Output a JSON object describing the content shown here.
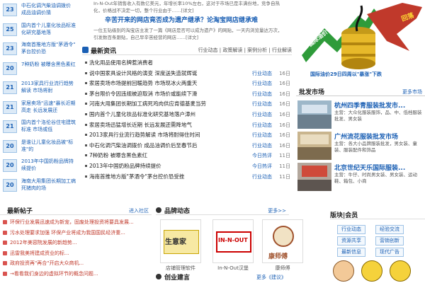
{
  "left_list": [
    {
      "day": "23",
      "text": "中石化调汽柴油调拨价 成品油调价猜"
    },
    {
      "day": "25",
      "text": "国内首个儿童化妆品标准化研究基地落"
    },
    {
      "day": "23",
      "text": "海南首推地方版\"茅酒令\" 茅台控价恐"
    },
    {
      "day": "20",
      "text": "7种奶粉 被曝含黑色素红"
    },
    {
      "day": "21",
      "text": "2013家具行业流行趋势解读 市场将耐"
    },
    {
      "day": "21",
      "text": "家居卖场\"迅速\"暴长近期高走 长远发展还"
    },
    {
      "day": "21",
      "text": "国内首个洛伦谷住宅建筑标准 市场或低"
    },
    {
      "day": "20",
      "text": "是谁让儿童化妆品被\"标准\"的"
    },
    {
      "day": "20",
      "text": "2013年中国奶粉品牌持续提价"
    },
    {
      "day": "20",
      "text": "海南大用集团长期加工病死猪肉的场"
    }
  ],
  "midtop": {
    "p1": "In-N-Out年销售收入有数亿美元，年增长率10%左右，这对于市场已是丰满份地，竞争自热化，价格战不决定一切，整个行业由于……[详文]",
    "headline": "辛苦开来的网店竟否成为遗产继承？论淘宝网店继承难",
    "p2": "一位五钻级别的淘宝店主发了一篇《网店是否可以成为遗产》的网贴，一天内浏览量达万次，引发数百条跟贴，自己早辛苦经营的网店……[详文]"
  },
  "news": {
    "title": "最新资讯",
    "tabs": "行业动态 | 政策解读 | 案例分析 | 行业解读",
    "items": [
      {
        "t": "洗化用品使用名牌惹消费者",
        "c": "",
        "d": ""
      },
      {
        "t": "说中国家具设计风格的演变 深度送失造就辉诞",
        "c": "行业动态",
        "d": "16日"
      },
      {
        "t": "家居卖场市场提前回暖趋势 市场现冰火两重天",
        "c": "行业动态",
        "d": "16日"
      },
      {
        "t": "茅台限价令因违规被迫取消 市场价或能续下滑",
        "c": "行业动态",
        "d": "16日"
      },
      {
        "t": "河南大用集团长期加工病死鸡肉供应肯德基麦当劳",
        "c": "行业动态",
        "d": "16日"
      },
      {
        "t": "国内首个儿童化妆品标准化研究基地落户漳州",
        "c": "行业动态",
        "d": "16日"
      },
      {
        "t": "家居卖场迅猛增长近期 长远发展还需降地气",
        "c": "行业动态",
        "d": "16日"
      },
      {
        "t": "2013家具行业流行趋势解读 市场将耐得住时间",
        "c": "行业动态",
        "d": "16日"
      },
      {
        "t": "中石化调汽柴油调拨价 成品油调价后至春节后",
        "c": "行业动态",
        "d": "16日"
      },
      {
        "t": "7种奶粉 被曝含黑色素红",
        "c": "今日热评",
        "d": "11日"
      },
      {
        "t": "2013年中国奶粉品牌持续提价",
        "c": "今日热评",
        "d": "11日"
      },
      {
        "t": "海南首推地方版\"茅酒令\"茅台控价恐受挫",
        "c": "行业动态",
        "d": "11日"
      }
    ]
  },
  "ad": {
    "banner": "国际油价29日四周以\"暴涨\"下跌"
  },
  "market": {
    "title": "批发市场",
    "more": "更多市场",
    "items": [
      {
        "name": "杭州四季青服装批发市...",
        "desc": "主营：大众化服装服饰，品、中、低档服装批发、男女装"
      },
      {
        "name": "广州流花服装批发市场",
        "desc": "主营：各大小品牌服装批发，男女装、童装、服装配件和饰品"
      },
      {
        "name": "北京世纪天乐国际服装...",
        "desc": "主营：牛仔、时尚男女装、男女装、运动鞋、箱包、小商"
      }
    ]
  },
  "posts": {
    "title": "最新帖子",
    "more": "进入社区",
    "items": [
      "环保行业发展迅速成为新宠，固废处理投资将要具发展...",
      "污水处理要求加强 环保产业将成为我国国民经济重...",
      "2012年美容院发展的新趋势...",
      "迅雷我美将建成资业的标...",
      "政府投资再\"再合\"开启大众商机...",
      "→看看我们身边的虚拟环节的概念问题..."
    ]
  },
  "brand": {
    "title": "品牌动态",
    "more": "更多>>",
    "items": [
      {
        "label": "店铺管理软件",
        "logo": "生意家"
      },
      {
        "label": "In-N-Out汉堡",
        "logo": "IN-N-OUT"
      },
      {
        "label": "康师傅",
        "logo": "康师傅"
      }
    ]
  },
  "biz": {
    "title": "创业建言",
    "more": "更多《建议》"
  },
  "boards": {
    "title": "版块|会员",
    "items": [
      "行业动态",
      "经验交流",
      "资源共享",
      "营销创新",
      "最新信息",
      "现代广告"
    ]
  }
}
